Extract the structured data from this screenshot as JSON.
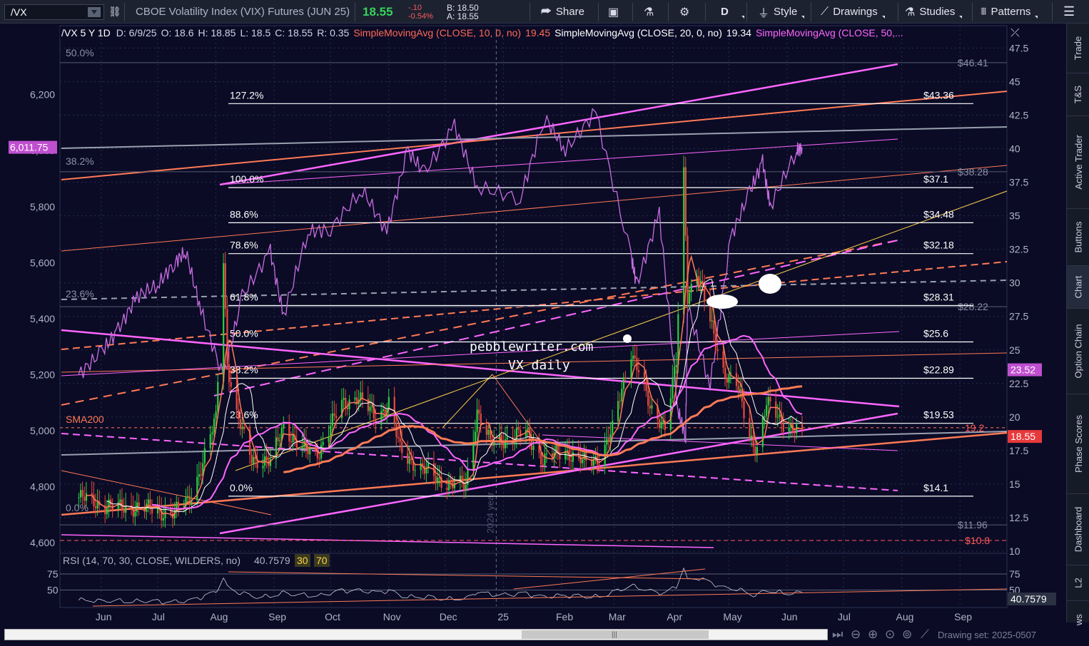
{
  "toolbar": {
    "symbol": "/VX",
    "description": "CBOE Volatility Index (VIX) Futures (JUN 25)",
    "last": "18.55",
    "change": "-.10",
    "change_pct": "-0.54%",
    "bid": "B: 18.50",
    "ask": "A: 18.55",
    "share": "Share",
    "aggregation": "D",
    "style": "Style",
    "drawings": "Drawings",
    "studies": "Studies",
    "patterns": "Patterns"
  },
  "sidetabs": [
    "Trade",
    "T&S",
    "Active Trader",
    "Buttons",
    "Chart",
    "Option Chain",
    "Phase Scores",
    "Dashboard",
    "L2",
    "News"
  ],
  "header": {
    "title": "/VX 5 Y 1D",
    "date": "D: 6/9/25",
    "open": "O: 18.6",
    "high": "H: 18.85",
    "low": "L: 18.5",
    "close": "C: 18.55",
    "range": "R: 0.35",
    "sma10_label": "SimpleMovingAvg (CLOSE, 10, 0, no)",
    "sma10_value": "19.45",
    "sma20_label": "SimpleMovingAvg (CLOSE, 20, 0, no)",
    "sma20_value": "19.34",
    "sma50_label": "SimpleMovingAvg (CLOSE, 50,..."
  },
  "colors": {
    "background": "#0b0b26",
    "bull": "#2ecc40",
    "bear": "#e84a3c",
    "sma_orange": "#ff7a55",
    "pink": "#ff66ff",
    "spx": "#c76de0",
    "white": "#ffffff",
    "grid": "#243050",
    "dollar_label": "#ffffff",
    "last_price_box": "#e8393c",
    "spx_box": "#c04fd0"
  },
  "chart_data": {
    "type": "candlestick",
    "title": "/VX 5 Y 1D",
    "x_ticks": [
      "Jun",
      "Jul",
      "Aug",
      "Sep",
      "Oct",
      "Nov",
      "Dec",
      "25",
      "Feb",
      "Mar",
      "Apr",
      "May",
      "Jun",
      "Jul",
      "Aug",
      "Sep"
    ],
    "x_tick_dates": [
      "2024-06-01",
      "2024-07-01",
      "2024-08-01",
      "2024-09-01",
      "2024-10-01",
      "2024-11-01",
      "2024-12-01",
      "2025-01-01",
      "2025-02-01",
      "2025-03-01",
      "2025-04-01",
      "2025-05-01",
      "2025-06-01",
      "2025-07-01",
      "2025-08-01",
      "2025-09-01"
    ],
    "year_divider_label": "2024 year",
    "right_axis_ticks": [
      "47.5",
      "45",
      "42.5",
      "40",
      "37.5",
      "35",
      "32.5",
      "30",
      "27.5",
      "25",
      "22.5",
      "20",
      "17.5",
      "15",
      "12.5",
      "10"
    ],
    "right_axis_range": [
      10,
      48
    ],
    "left_axis_ticks": [
      "6,200",
      "6,000",
      "5,800",
      "5,600",
      "5,400",
      "5,200",
      "5,000",
      "4,800",
      "4,600"
    ],
    "left_axis_range": [
      4570,
      6390
    ],
    "price_markers": [
      {
        "label": "23.52",
        "value": 23.52,
        "kind": "spx-overlay"
      },
      {
        "label": "19.2",
        "value": 19.2,
        "kind": "sma200"
      },
      {
        "label": "18.55",
        "value": 18.55,
        "kind": "last"
      }
    ],
    "left_marker": {
      "label": "6,011.75",
      "value": 6011.75
    },
    "fib_retracement": [
      {
        "label": "127.2%",
        "price_label": "$43.36",
        "value": 43.36
      },
      {
        "label": "100.0%",
        "price_label": "$37.1",
        "value": 37.1
      },
      {
        "label": "88.6%",
        "price_label": "$34.48",
        "value": 34.48
      },
      {
        "label": "78.6%",
        "price_label": "$32.18",
        "value": 32.18
      },
      {
        "label": "61.8%",
        "price_label": "$28.31",
        "value": 28.31
      },
      {
        "label": "50.0%",
        "price_label": "$25.6",
        "value": 25.6
      },
      {
        "label": "38.2%",
        "price_label": "$22.89",
        "value": 22.89
      },
      {
        "label": "23.6%",
        "price_label": "$19.53",
        "value": 19.53
      },
      {
        "label": "0.0%",
        "price_label": "$14.1",
        "value": 14.1
      }
    ],
    "fib_gray": [
      {
        "label": "50.0%",
        "price_label": "$46.41",
        "value": 46.41
      },
      {
        "label": "38.2%",
        "price_label": "$38.28",
        "value": 38.28
      },
      {
        "label": "23.6%",
        "price_label": "$28.22",
        "value": 28.22
      },
      {
        "label": "0.0%",
        "price_label": "$11.96",
        "value": 11.96
      }
    ],
    "red_level": {
      "label": "$10.8",
      "value": 10.8
    },
    "sma200_label": "SMA200",
    "annotation": [
      "pebblewriter.com",
      "VX daily"
    ],
    "vx_close_path": [
      [
        "2024-05-20",
        14.0
      ],
      [
        "2024-06-01",
        13.5
      ],
      [
        "2024-06-10",
        13.2
      ],
      [
        "2024-06-20",
        13.3
      ],
      [
        "2024-07-01",
        13.0
      ],
      [
        "2024-07-10",
        12.8
      ],
      [
        "2024-07-18",
        14.0
      ],
      [
        "2024-07-25",
        16.5
      ],
      [
        "2024-08-01",
        20.0
      ],
      [
        "2024-08-05",
        32.0
      ],
      [
        "2024-08-07",
        24.0
      ],
      [
        "2024-08-12",
        20.0
      ],
      [
        "2024-08-20",
        17.0
      ],
      [
        "2024-08-30",
        16.5
      ],
      [
        "2024-09-06",
        19.5
      ],
      [
        "2024-09-15",
        17.5
      ],
      [
        "2024-09-25",
        17.5
      ],
      [
        "2024-10-07",
        21.0
      ],
      [
        "2024-10-15",
        21.5
      ],
      [
        "2024-10-25",
        20.0
      ],
      [
        "2024-11-01",
        21.0
      ],
      [
        "2024-11-07",
        17.5
      ],
      [
        "2024-11-15",
        16.5
      ],
      [
        "2024-11-25",
        15.5
      ],
      [
        "2024-12-05",
        15.0
      ],
      [
        "2024-12-12",
        14.8
      ],
      [
        "2024-12-18",
        20.5
      ],
      [
        "2024-12-25",
        18.0
      ],
      [
        "2025-01-05",
        18.5
      ],
      [
        "2025-01-13",
        18.8
      ],
      [
        "2025-01-22",
        16.8
      ],
      [
        "2025-02-03",
        17.5
      ],
      [
        "2025-02-14",
        16.5
      ],
      [
        "2025-02-21",
        17.0
      ],
      [
        "2025-02-28",
        19.0
      ],
      [
        "2025-03-05",
        22.0
      ],
      [
        "2025-03-10",
        25.0
      ],
      [
        "2025-03-14",
        23.5
      ],
      [
        "2025-03-20",
        20.5
      ],
      [
        "2025-03-28",
        19.5
      ],
      [
        "2025-04-03",
        24.0
      ],
      [
        "2025-04-07",
        38.0
      ],
      [
        "2025-04-09",
        29.0
      ],
      [
        "2025-04-14",
        31.0
      ],
      [
        "2025-04-21",
        27.0
      ],
      [
        "2025-04-28",
        23.5
      ],
      [
        "2025-05-05",
        22.5
      ],
      [
        "2025-05-12",
        18.5
      ],
      [
        "2025-05-16",
        17.8
      ],
      [
        "2025-05-21",
        21.0
      ],
      [
        "2025-05-28",
        19.8
      ],
      [
        "2025-06-04",
        19.2
      ],
      [
        "2025-06-09",
        18.55
      ]
    ],
    "spx_path": [
      [
        "2024-05-20",
        5200
      ],
      [
        "2024-06-01",
        5280
      ],
      [
        "2024-06-10",
        5360
      ],
      [
        "2024-06-20",
        5480
      ],
      [
        "2024-07-01",
        5520
      ],
      [
        "2024-07-10",
        5600
      ],
      [
        "2024-07-16",
        5640
      ],
      [
        "2024-07-24",
        5430
      ],
      [
        "2024-08-05",
        5190
      ],
      [
        "2024-08-15",
        5480
      ],
      [
        "2024-08-30",
        5640
      ],
      [
        "2024-09-06",
        5410
      ],
      [
        "2024-09-19",
        5710
      ],
      [
        "2024-10-01",
        5720
      ],
      [
        "2024-10-18",
        5860
      ],
      [
        "2024-10-31",
        5710
      ],
      [
        "2024-11-11",
        6000
      ],
      [
        "2024-11-20",
        5920
      ],
      [
        "2024-12-06",
        6090
      ],
      [
        "2024-12-18",
        5870
      ],
      [
        "2025-01-10",
        5830
      ],
      [
        "2025-01-23",
        6120
      ],
      [
        "2025-02-03",
        6000
      ],
      [
        "2025-02-19",
        6140
      ],
      [
        "2025-03-10",
        5620
      ],
      [
        "2025-03-13",
        5520
      ],
      [
        "2025-03-25",
        5780
      ],
      [
        "2025-04-04",
        5070
      ],
      [
        "2025-04-08",
        4980
      ],
      [
        "2025-04-09",
        5450
      ],
      [
        "2025-04-21",
        5160
      ],
      [
        "2025-05-02",
        5690
      ],
      [
        "2025-05-12",
        5850
      ],
      [
        "2025-05-19",
        5960
      ],
      [
        "2025-05-23",
        5800
      ],
      [
        "2025-06-06",
        6000
      ],
      [
        "2025-06-09",
        6011.75
      ]
    ],
    "rsi": {
      "label": "RSI (14, 70, 30, CLOSE, WILDERS, no)",
      "value": "40.7579",
      "oversold": "30",
      "overbought": "70",
      "ticks": [
        "75",
        "50"
      ],
      "range": [
        25,
        85
      ]
    }
  },
  "bottombar": {
    "drawing_set": "Drawing set: 2025-0507"
  }
}
